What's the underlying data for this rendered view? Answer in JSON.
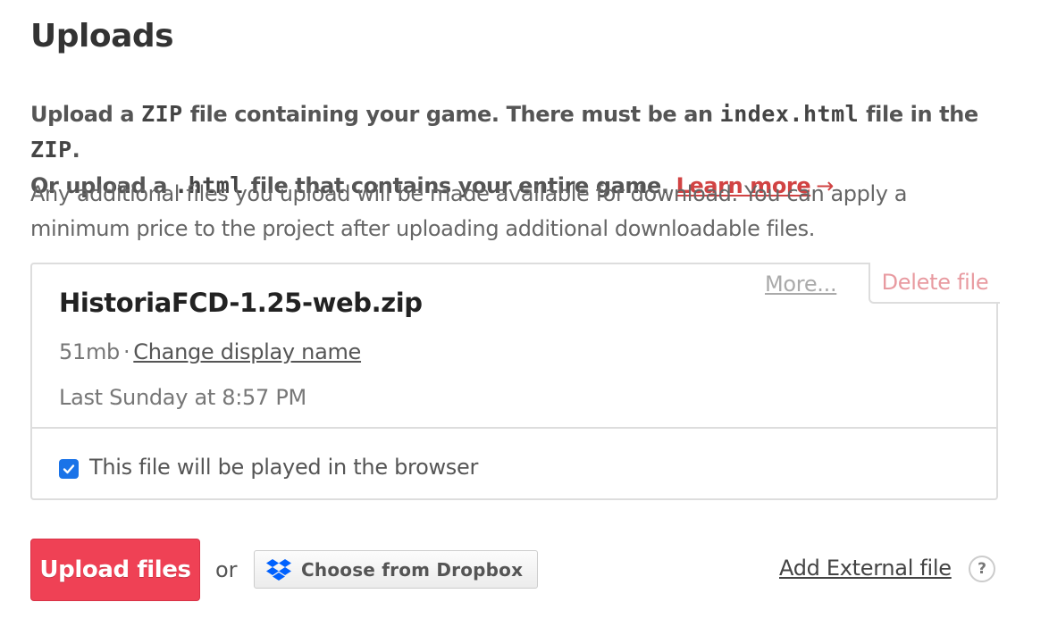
{
  "header": {
    "title": "Uploads"
  },
  "intro": {
    "part1": "Upload a ",
    "code1": "ZIP",
    "part2": " file containing your game. There must be an ",
    "code2": "index.html",
    "part3": " file in the ",
    "code3": "ZIP",
    "part4": ".",
    "part5": "Or upload a ",
    "code4": ".html",
    "part6": " file that contains your entire game. ",
    "learn_more": "Learn more",
    "arrow": "→"
  },
  "note": "Any additional files you upload will be made available for download. You can apply a minimum price to the project after uploading additional downloadable files.",
  "file": {
    "name": "HistoriaFCD-1.25-web.zip",
    "size": "51mb",
    "separator": "·",
    "change_display_name": "Change display name",
    "date": "Last Sunday at 8:57 PM",
    "more_label": "More...",
    "delete_label": "Delete file",
    "browser_label": "This file will be played in the browser",
    "browser_checked": true
  },
  "actions": {
    "upload_label": "Upload files",
    "or_label": "or",
    "dropbox_label": "Choose from Dropbox",
    "external_label": "Add External file",
    "help_label": "?"
  },
  "colors": {
    "accent": "#ef4155",
    "link_red": "#d14343",
    "checkbox_blue": "#1a73e8",
    "dropbox_blue": "#0061fe"
  }
}
